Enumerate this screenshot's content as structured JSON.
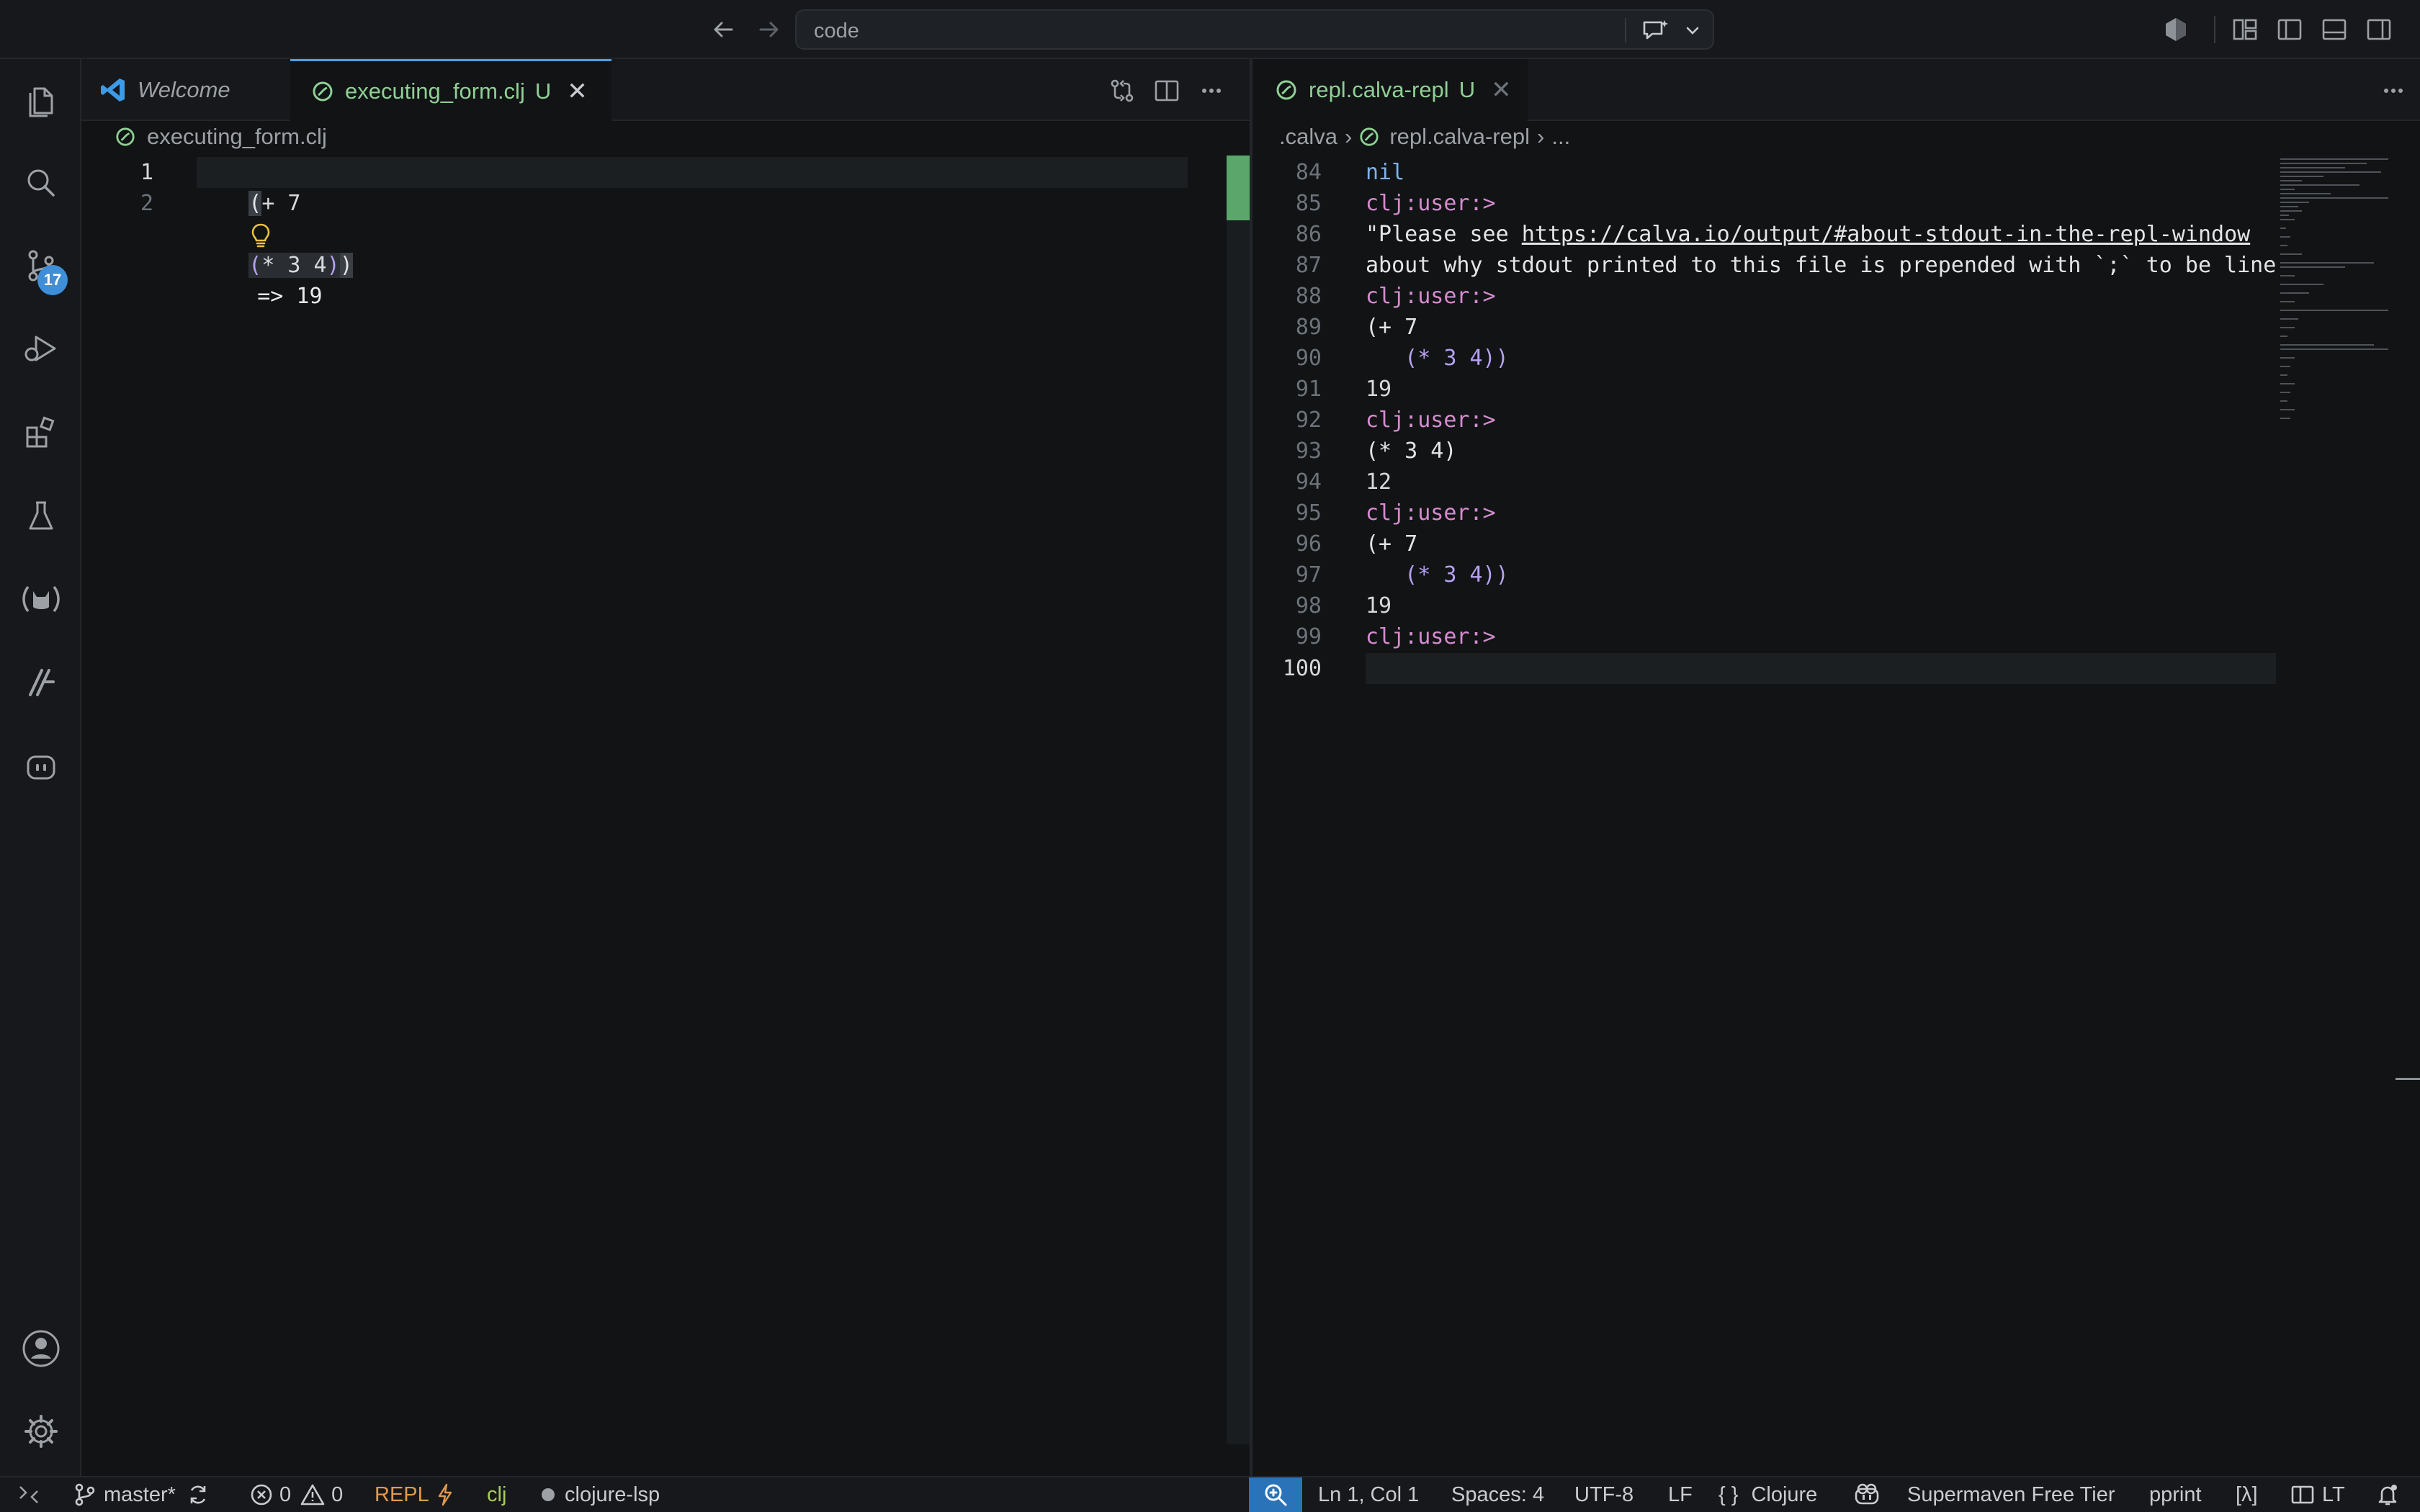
{
  "titlebar": {
    "command_center_text": "code"
  },
  "activity_bar": {
    "source_control_badge": "17"
  },
  "left_editor": {
    "tabs": [
      {
        "label": "Welcome"
      },
      {
        "label": "executing_form.clj",
        "status": "U"
      }
    ],
    "breadcrumb": "executing_form.clj",
    "lines": [
      {
        "number": "1",
        "text": "(+ 7"
      },
      {
        "number": "2",
        "text": "(* 3 4))",
        "inline_result": "=> 19"
      }
    ]
  },
  "right_editor": {
    "tab": {
      "label": "repl.calva-repl",
      "status": "U"
    },
    "breadcrumb": [
      ".calva",
      "repl.calva-repl",
      "..."
    ],
    "lines": [
      {
        "number": "84",
        "text": "nil"
      },
      {
        "number": "85",
        "text": "clj:user:>"
      },
      {
        "number": "86",
        "text": "\"Please see ",
        "link": "https://calva.io/output/#about-stdout-in-the-repl-window"
      },
      {
        "number": "87",
        "text": "about why stdout printed to this file is prepended with `;` to be line co"
      },
      {
        "number": "88",
        "text": "clj:user:>"
      },
      {
        "number": "89",
        "text": "(+ 7"
      },
      {
        "number": "90",
        "text": "   (* 3 4))"
      },
      {
        "number": "91",
        "text": "19"
      },
      {
        "number": "92",
        "text": "clj:user:>"
      },
      {
        "number": "93",
        "text": "(* 3 4)"
      },
      {
        "number": "94",
        "text": "12"
      },
      {
        "number": "95",
        "text": "clj:user:>"
      },
      {
        "number": "96",
        "text": "(+ 7"
      },
      {
        "number": "97",
        "text": "   (* 3 4))"
      },
      {
        "number": "98",
        "text": "19"
      },
      {
        "number": "99",
        "text": "clj:user:>"
      },
      {
        "number": "100",
        "text": ""
      }
    ]
  },
  "status_bar": {
    "branch": "master*",
    "errors": "0",
    "warnings": "0",
    "repl": "REPL",
    "lang_short": "clj",
    "lsp": "clojure-lsp",
    "cursor": "Ln 1, Col 1",
    "spaces": "Spaces: 4",
    "encoding": "UTF-8",
    "eol": "LF",
    "language": "Clojure",
    "supermaven": "Supermaven Free Tier",
    "pprint": "pprint",
    "lambda": "[λ]",
    "lt": "LT"
  },
  "colors": {
    "accent": "#2b73b8",
    "repl_orange": "#e0994f",
    "clj_green": "#a8cc5c",
    "modified_green": "#8fd094"
  }
}
